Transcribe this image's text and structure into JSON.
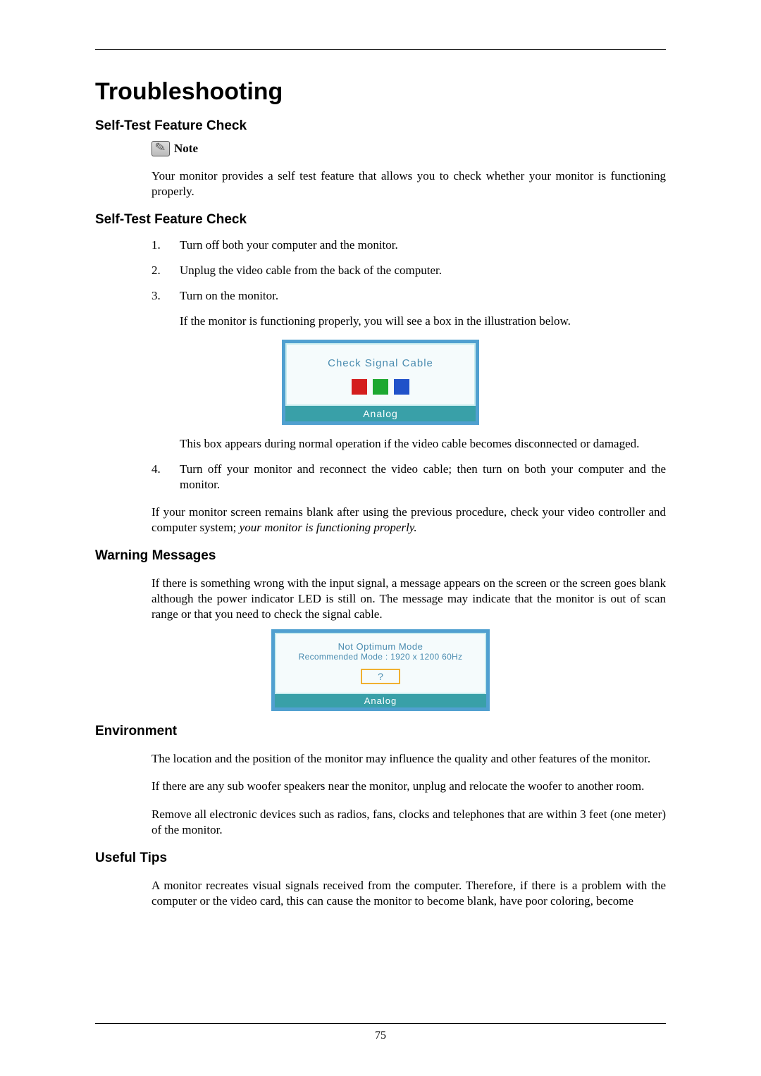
{
  "title": "Troubleshooting",
  "page_number": "75",
  "sections": {
    "self_test_1": {
      "heading": "Self-Test Feature Check",
      "note_label": "Note",
      "note_body": "Your monitor provides a self test feature that allows you to check whether your monitor is functioning properly."
    },
    "self_test_2": {
      "heading": "Self-Test Feature Check",
      "steps": [
        "Turn off both your computer and the monitor.",
        "Unplug the video cable from the back of the computer.",
        "Turn on the monitor."
      ],
      "step3_followup": "If the monitor is functioning properly, you will see a box in the illustration below.",
      "illus1": {
        "message": "Check Signal Cable",
        "bar": "Analog"
      },
      "after_illus1": "This box appears during normal operation if the video cable becomes disconnected or damaged.",
      "step4": "Turn off your monitor and reconnect the video cable; then turn on both your computer and the monitor.",
      "closing_plain": "If your monitor screen remains blank after using the previous procedure, check your video controller and computer system; ",
      "closing_italic": "your monitor is functioning properly."
    },
    "warning": {
      "heading": "Warning Messages",
      "body": "If there is something wrong with the input signal, a message appears on the screen or the screen goes blank although the power indicator LED is still on. The message may indicate that the monitor is out of scan range or that you need to check the signal cable.",
      "illus2": {
        "line1": "Not Optimum Mode",
        "line2": "Recommended Mode : 1920 x 1200  60Hz",
        "q": "?",
        "bar": "Analog"
      }
    },
    "environment": {
      "heading": "Environment",
      "p1": "The location and the position of the monitor may influence the quality and other features of the monitor.",
      "p2": "If there are any sub woofer speakers near the monitor, unplug and relocate the woofer to another room.",
      "p3": "Remove all electronic devices such as radios, fans, clocks and telephones that are within 3 feet (one meter) of the monitor."
    },
    "tips": {
      "heading": "Useful Tips",
      "p1": "A monitor recreates visual signals received from the computer. Therefore, if there is a problem with the computer or the video card, this can cause the monitor to become blank, have poor coloring, become"
    }
  }
}
